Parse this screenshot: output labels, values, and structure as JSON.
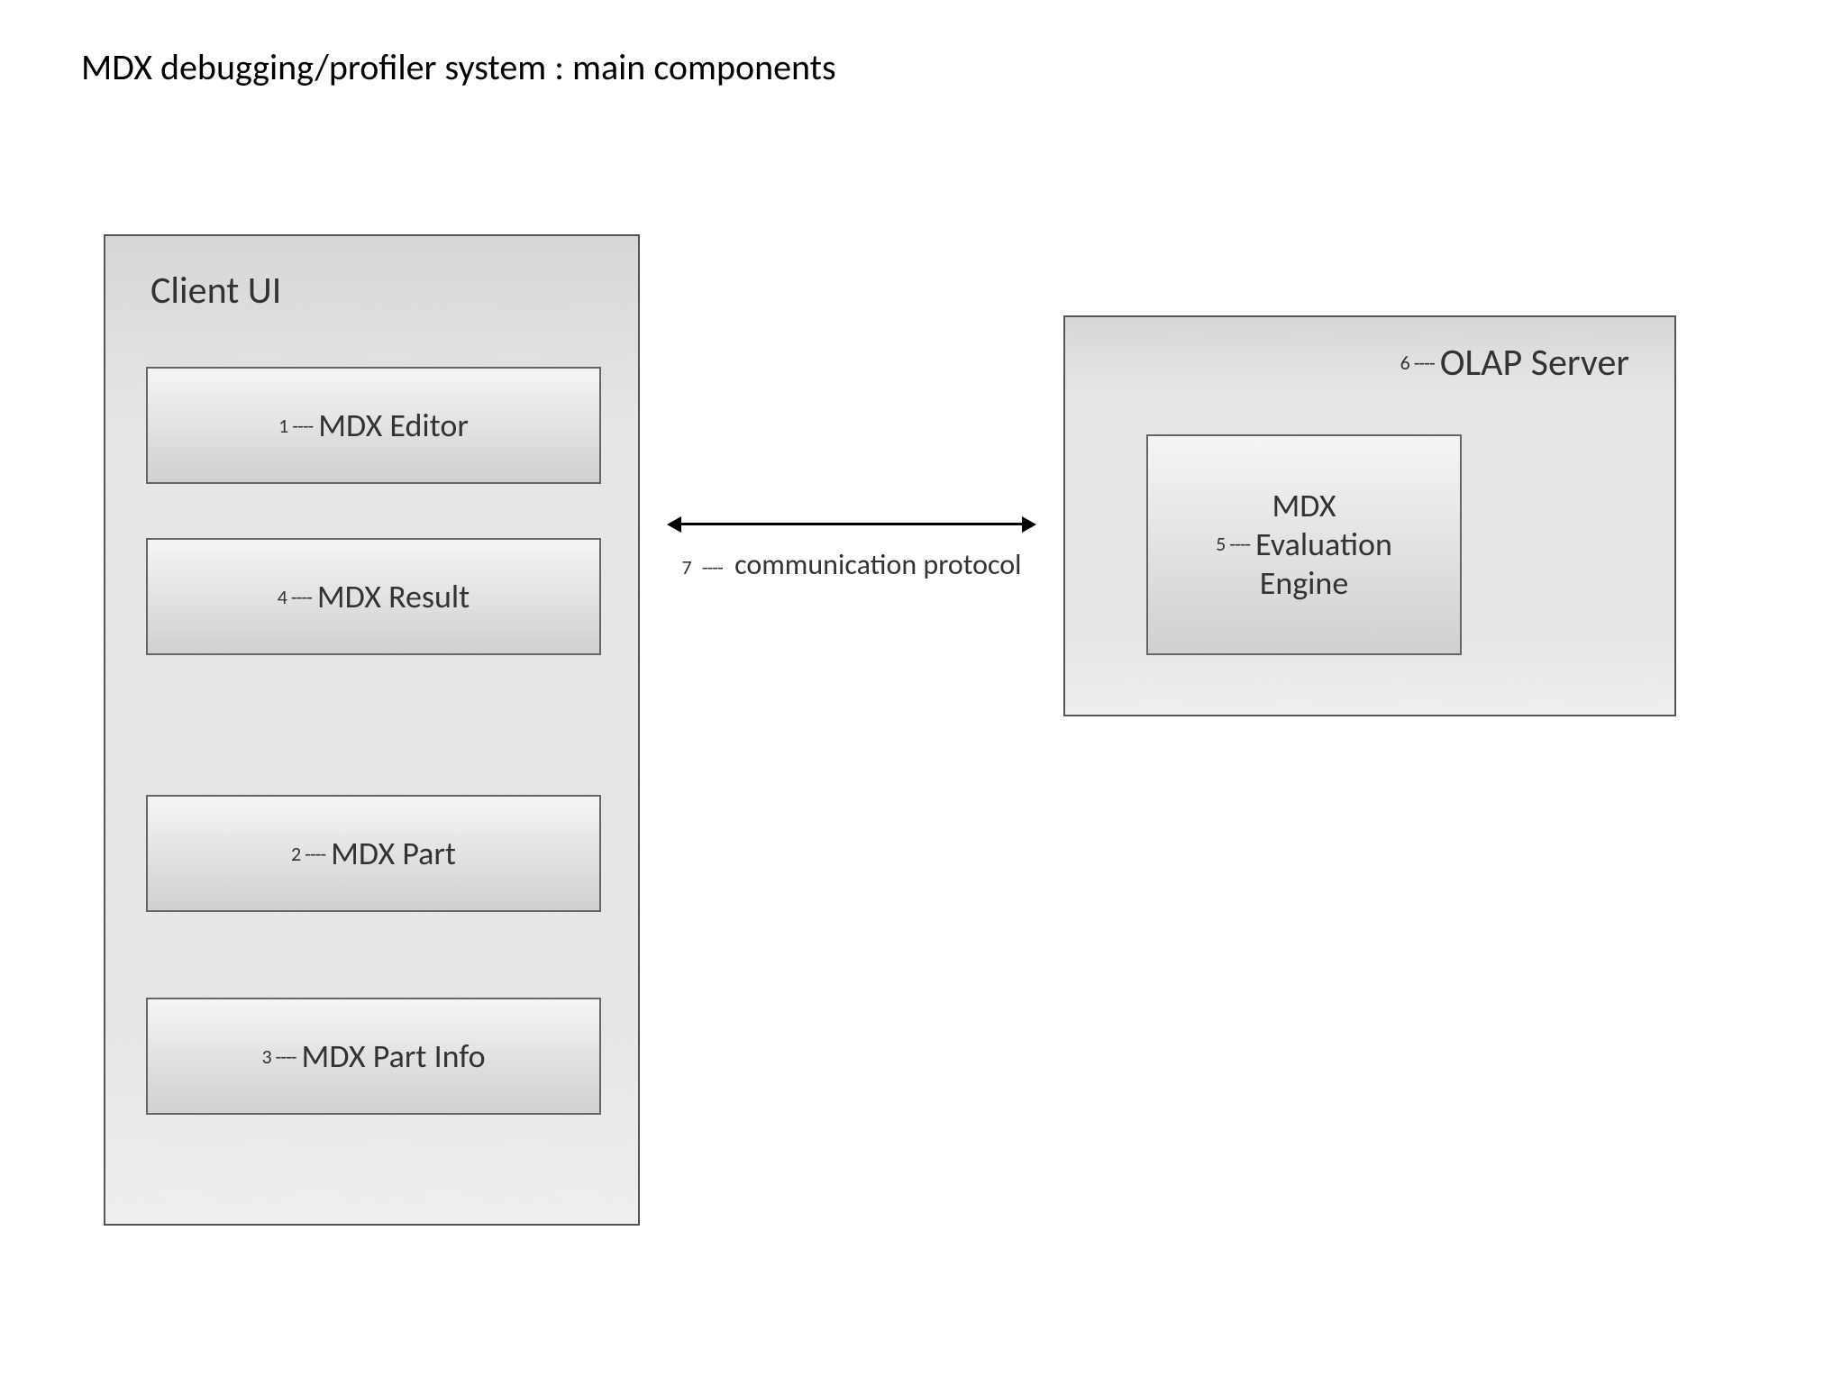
{
  "title": "MDX debugging/profiler system : main components",
  "client_ui": {
    "label": "Client UI",
    "items": [
      {
        "ref": "1",
        "label": "MDX Editor"
      },
      {
        "ref": "4",
        "label": "MDX Result"
      },
      {
        "ref": "2",
        "label": "MDX Part"
      },
      {
        "ref": "3",
        "label": "MDX Part Info"
      }
    ]
  },
  "olap_server": {
    "ref": "6",
    "label": "OLAP Server",
    "engine": {
      "ref": "5",
      "line1": "MDX",
      "line2": "Evaluation",
      "line3": "Engine"
    }
  },
  "connection": {
    "ref": "7",
    "label": "communication protocol"
  },
  "dash": "----"
}
